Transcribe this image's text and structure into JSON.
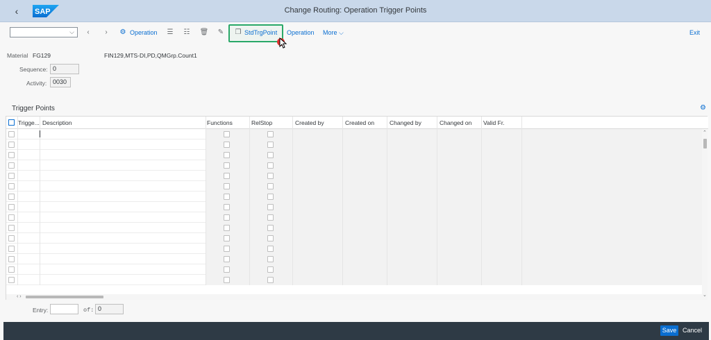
{
  "window": {
    "title": "Change Routing: Operation Trigger Points",
    "logo_text": "SAP"
  },
  "toolbar": {
    "select_value": "",
    "operation_btn1": "Operation",
    "std_trg_point": "StdTrgPoint",
    "operation_btn2": "Operation",
    "more": "More",
    "exit": "Exit"
  },
  "header": {
    "material_label": "Material",
    "material_value": "FG129",
    "description": "FIN129,MTS-DI,PD,QMGrp.Count1",
    "sequence_label": "Sequence:",
    "sequence_value": "0",
    "activity_label": "Activity:",
    "activity_value": "0030"
  },
  "table": {
    "title": "Trigger Points",
    "columns": [
      "Trigge...",
      "Description",
      "Functions",
      "RelStop",
      "Created by",
      "Created on",
      "Changed by",
      "Changed on",
      "Valid Fr."
    ],
    "row_count": 15
  },
  "entry": {
    "entry_label": "Entry:",
    "entry_value": "",
    "of_label": "of:",
    "of_value": "0"
  },
  "footer": {
    "save": "Save",
    "cancel": "Cancel"
  },
  "colors": {
    "titlebar": "#c9d8ea",
    "accent": "#0a6ed1",
    "highlight_border": "#2aa868",
    "footer": "#2e3a45"
  }
}
